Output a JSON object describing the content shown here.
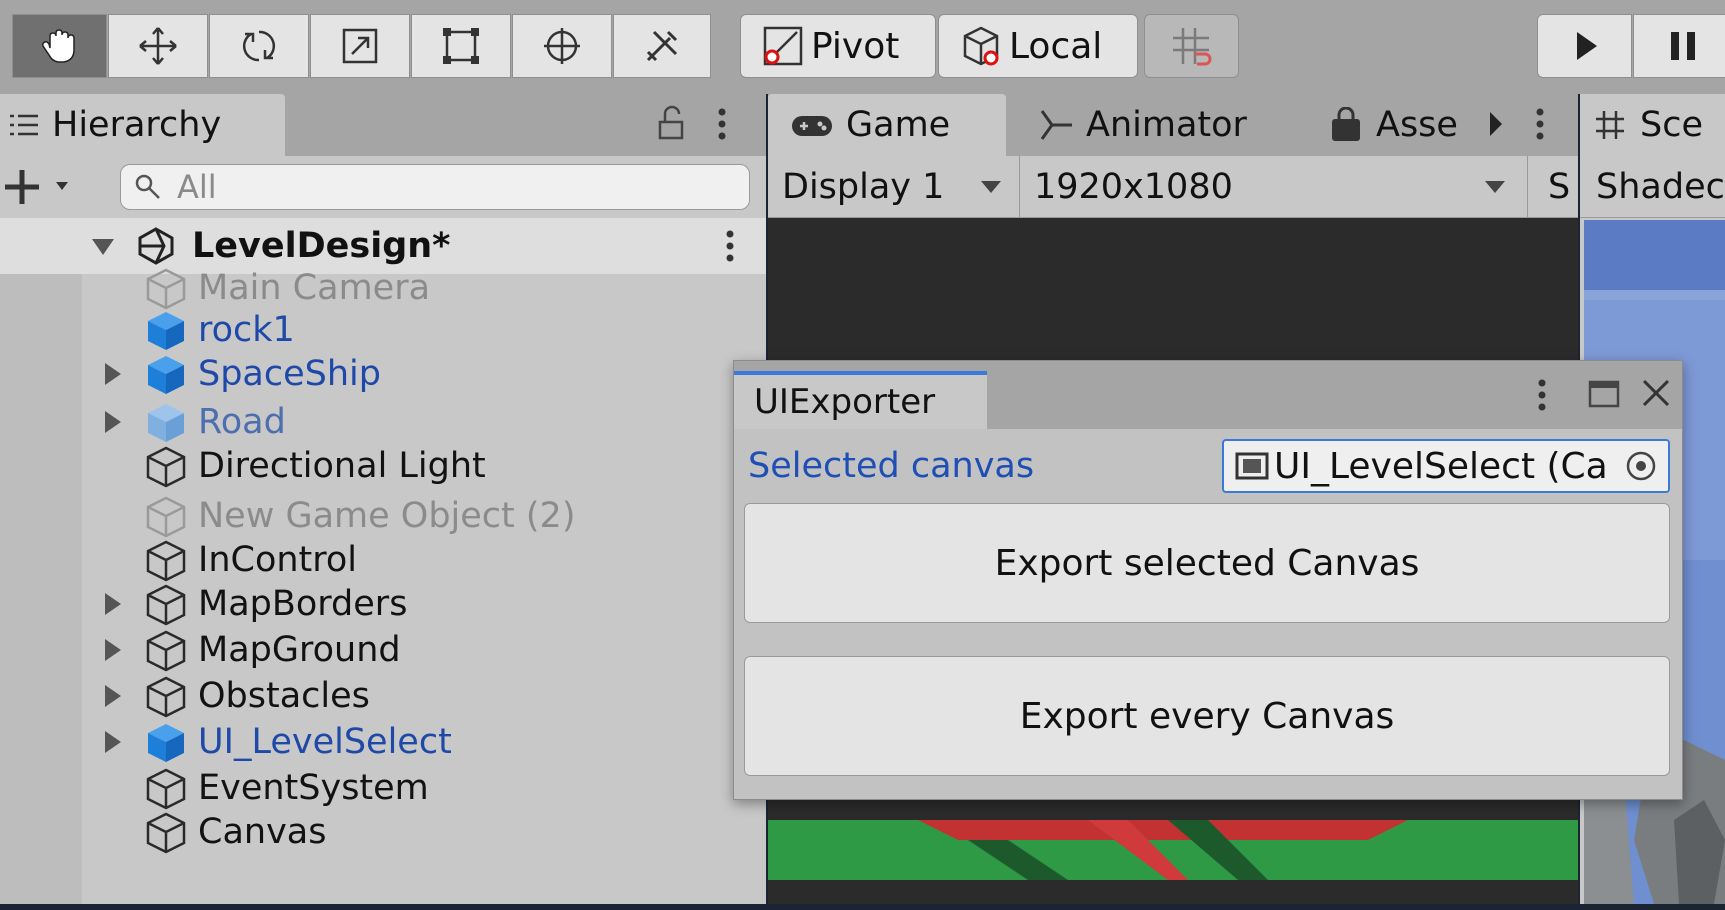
{
  "toolbar": {
    "tools": [
      "hand-tool",
      "move-tool",
      "rotate-tool",
      "scale-tool",
      "rect-tool",
      "transform-tool",
      "custom-tool"
    ],
    "pivot_label": "Pivot",
    "local_label": "Local"
  },
  "hierarchy": {
    "tab_label": "Hierarchy",
    "search_placeholder": "All",
    "scene_name": "LevelDesign*",
    "items": [
      {
        "label": "Main Camera",
        "state": "disabled",
        "foldout": false,
        "icon": "cube-outline-icon"
      },
      {
        "label": "rock1",
        "state": "prefab",
        "foldout": false,
        "icon": "prefab-cube-icon"
      },
      {
        "label": "SpaceShip",
        "state": "prefab",
        "foldout": true,
        "icon": "prefab-cube-icon"
      },
      {
        "label": "Road",
        "state": "prefab-faded",
        "foldout": true,
        "icon": "prefab-cube-icon"
      },
      {
        "label": "Directional Light",
        "state": "normal",
        "foldout": false,
        "icon": "cube-outline-icon"
      },
      {
        "label": "New Game Object (2)",
        "state": "disabled",
        "foldout": false,
        "icon": "cube-outline-icon"
      },
      {
        "label": "InControl",
        "state": "normal",
        "foldout": false,
        "icon": "cube-outline-icon"
      },
      {
        "label": "MapBorders",
        "state": "normal",
        "foldout": true,
        "icon": "cube-outline-icon"
      },
      {
        "label": "MapGround",
        "state": "normal",
        "foldout": true,
        "icon": "cube-outline-icon"
      },
      {
        "label": "Obstacles",
        "state": "normal",
        "foldout": true,
        "icon": "cube-outline-icon"
      },
      {
        "label": "UI_LevelSelect",
        "state": "prefab",
        "foldout": true,
        "icon": "prefab-cube-icon"
      },
      {
        "label": "EventSystem",
        "state": "normal",
        "foldout": false,
        "icon": "cube-outline-icon"
      },
      {
        "label": "Canvas",
        "state": "normal",
        "foldout": false,
        "icon": "cube-outline-icon"
      }
    ]
  },
  "game": {
    "tabs": [
      "Game",
      "Animator",
      "Asse"
    ],
    "display_label": "Display 1",
    "resolution_label": "1920x1080",
    "extra_label": "S"
  },
  "scene": {
    "tab_label": "Sce",
    "shading_label": "Shadec"
  },
  "exporter": {
    "tab_label": "UIExporter",
    "selected_canvas_label": "Selected canvas",
    "canvas_field_value": "UI_LevelSelect (Ca",
    "export_selected_label": "Export selected Canvas",
    "export_every_label": "Export every Canvas"
  },
  "colors": {
    "accent": "#3a79d7",
    "prefab_blue": "#1f49a8",
    "toolbar_bg": "#a5a5a5",
    "panel_bg": "#c8c8c8",
    "game_ground_green": "#2f9a45",
    "game_red": "#d03a3a"
  }
}
